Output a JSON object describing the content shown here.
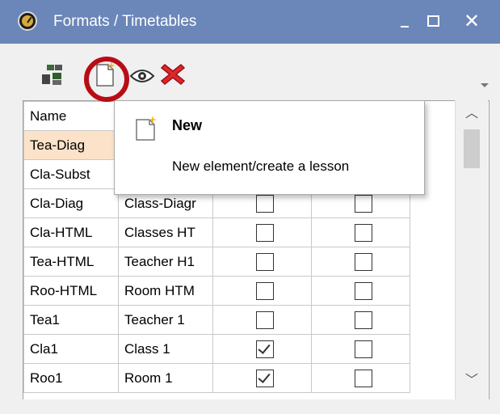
{
  "window": {
    "title": "Formats / Timetables",
    "close_glyph": "✕"
  },
  "toolbar": {
    "icons": [
      "properties-icon",
      "new-document-icon",
      "preview-eye-icon",
      "delete-x-icon"
    ],
    "highlight_color": "#b80d16"
  },
  "grid": {
    "header": "Name",
    "rows": [
      {
        "name": "Tea-Diag",
        "long_name": "",
        "cb1": null,
        "cb2": null,
        "highlighted": true
      },
      {
        "name": "Cla-Subst",
        "long_name": "",
        "cb1": null,
        "cb2": null
      },
      {
        "name": "Cla-Diag",
        "long_name": "Class-Diagr",
        "cb1": false,
        "cb2": false
      },
      {
        "name": "Cla-HTML",
        "long_name": "Classes HT",
        "cb1": false,
        "cb2": false
      },
      {
        "name": "Tea-HTML",
        "long_name": "Teacher H1",
        "cb1": false,
        "cb2": false
      },
      {
        "name": "Roo-HTML",
        "long_name": "Room HTM",
        "cb1": false,
        "cb2": false
      },
      {
        "name": "Tea1",
        "long_name": "Teacher 1",
        "cb1": false,
        "cb2": false
      },
      {
        "name": "Cla1",
        "long_name": "Class 1",
        "cb1": true,
        "cb2": false
      },
      {
        "name": "Roo1",
        "long_name": "Room 1",
        "cb1": true,
        "cb2": false
      }
    ]
  },
  "popup": {
    "title": "New",
    "description": "New element/create a lesson"
  },
  "colors": {
    "titlebar": "#6b86b8",
    "highlight_row": "#fbe2c8"
  }
}
